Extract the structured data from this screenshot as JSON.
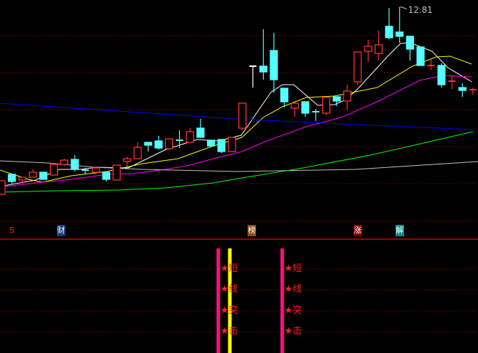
{
  "chart_data": {
    "type": "candlestick",
    "title": "",
    "max_label": "12.81",
    "grid": true,
    "colors": {
      "up": "#ff3030",
      "down": "#54ffff",
      "flat": "#ffffff",
      "grid": "#c00000"
    },
    "candles": [
      [
        7.55,
        7.93,
        7.55,
        7.93,
        "up"
      ],
      [
        8.11,
        8.11,
        7.85,
        7.91,
        "down"
      ],
      [
        7.95,
        8.03,
        7.85,
        8.03,
        "up"
      ],
      [
        8.03,
        8.25,
        8.03,
        8.17,
        "up"
      ],
      [
        8.17,
        8.17,
        7.97,
        7.97,
        "down"
      ],
      [
        8.09,
        8.39,
        8.09,
        8.39,
        "up"
      ],
      [
        8.39,
        8.55,
        8.35,
        8.51,
        "up"
      ],
      [
        8.53,
        8.65,
        8.19,
        8.27,
        "down"
      ],
      [
        8.23,
        8.29,
        8.11,
        8.23,
        "down"
      ],
      [
        8.17,
        8.29,
        8.11,
        8.29,
        "up"
      ],
      [
        8.17,
        8.17,
        7.91,
        7.97,
        "down"
      ],
      [
        7.95,
        8.37,
        7.95,
        8.37,
        "up"
      ],
      [
        8.47,
        8.61,
        8.33,
        8.55,
        "up"
      ],
      [
        8.55,
        9.01,
        8.55,
        8.87,
        "up"
      ],
      [
        9.01,
        9.01,
        8.75,
        8.93,
        "down"
      ],
      [
        9.05,
        9.19,
        8.81,
        8.85,
        "down"
      ],
      [
        8.83,
        9.11,
        8.79,
        9.11,
        "up"
      ],
      [
        9.07,
        9.35,
        8.85,
        9.07,
        "down"
      ],
      [
        9.01,
        9.41,
        9.01,
        9.31,
        "up"
      ],
      [
        9.41,
        9.67,
        9.15,
        9.15,
        "down"
      ],
      [
        9.07,
        9.07,
        8.91,
        8.91,
        "down"
      ],
      [
        9.09,
        9.09,
        8.71,
        8.75,
        "down"
      ],
      [
        8.75,
        9.15,
        8.75,
        9.15,
        "up"
      ],
      [
        9.41,
        10.11,
        9.35,
        10.11,
        "up"
      ],
      [
        11.15,
        11.15,
        10.55,
        11.15,
        "flat"
      ],
      [
        11.15,
        12.19,
        10.77,
        10.99,
        "down"
      ],
      [
        11.59,
        12.09,
        10.41,
        10.77,
        "down"
      ],
      [
        10.53,
        10.53,
        9.99,
        10.15,
        "down"
      ],
      [
        9.97,
        10.13,
        9.73,
        10.11,
        "up"
      ],
      [
        10.15,
        10.15,
        9.73,
        9.83,
        "down"
      ],
      [
        9.87,
        9.95,
        9.61,
        9.87,
        "down"
      ],
      [
        9.83,
        10.27,
        9.77,
        10.27,
        "up"
      ],
      [
        10.29,
        10.29,
        10.03,
        10.17,
        "down"
      ],
      [
        10.17,
        10.63,
        9.91,
        10.45,
        "up"
      ],
      [
        10.71,
        11.55,
        10.61,
        11.55,
        "up"
      ],
      [
        11.57,
        11.89,
        11.27,
        11.71,
        "up"
      ],
      [
        11.51,
        12.15,
        11.31,
        11.75,
        "up"
      ],
      [
        12.27,
        12.79,
        11.91,
        11.95,
        "down"
      ],
      [
        12.11,
        12.81,
        11.81,
        11.99,
        "down"
      ],
      [
        11.99,
        11.99,
        11.31,
        11.63,
        "down"
      ],
      [
        11.69,
        11.69,
        11.17,
        11.17,
        "down"
      ],
      [
        11.17,
        11.35,
        11.05,
        11.17,
        "up"
      ],
      [
        11.17,
        11.23,
        10.55,
        10.63,
        "down"
      ],
      [
        10.73,
        10.87,
        10.51,
        10.73,
        "up"
      ],
      [
        10.55,
        10.67,
        10.29,
        10.47,
        "down"
      ],
      [
        10.49,
        10.55,
        10.35,
        10.49,
        "up"
      ]
    ],
    "lines": [
      {
        "color": "#ffffff",
        "points": [
          [
            0.86,
            7.77
          ],
          [
            4.26,
            7.95
          ],
          [
            6.5,
            8.25
          ],
          [
            8.5,
            8.25
          ],
          [
            10.2,
            8.31
          ],
          [
            13.1,
            8.29
          ],
          [
            16.7,
            8.81
          ],
          [
            19.7,
            9.09
          ],
          [
            21.7,
            9.05
          ],
          [
            23.9,
            9.21
          ],
          [
            26.7,
            10.41
          ],
          [
            27.8,
            10.63
          ],
          [
            28.9,
            10.63
          ],
          [
            31.2,
            10.05
          ],
          [
            32.8,
            10.07
          ],
          [
            33.9,
            10.21
          ],
          [
            35.0,
            10.51
          ],
          [
            38.0,
            11.47
          ],
          [
            39.1,
            11.79
          ],
          [
            40.0,
            11.81
          ],
          [
            42.1,
            11.57
          ],
          [
            43.6,
            11.11
          ],
          [
            45.9,
            10.71
          ]
        ]
      },
      {
        "color": "#ffff00",
        "points": [
          [
            0.86,
            8.23
          ],
          [
            3.58,
            7.97
          ],
          [
            4.94,
            7.89
          ],
          [
            7.65,
            8.07
          ],
          [
            11.05,
            8.19
          ],
          [
            14.44,
            8.41
          ],
          [
            17.84,
            8.55
          ],
          [
            21.23,
            8.91
          ],
          [
            23.95,
            9.15
          ],
          [
            25.98,
            9.71
          ],
          [
            27.82,
            10.01
          ],
          [
            30.06,
            10.27
          ],
          [
            32.77,
            10.31
          ],
          [
            36.85,
            10.55
          ],
          [
            40.24,
            11.15
          ],
          [
            42.48,
            11.41
          ],
          [
            43.84,
            11.43
          ],
          [
            45.87,
            11.21
          ]
        ]
      },
      {
        "color": "#ff00ff",
        "points": [
          [
            0.86,
            7.75
          ],
          [
            4.26,
            7.87
          ],
          [
            7.65,
            7.97
          ],
          [
            11.05,
            8.11
          ],
          [
            13.56,
            8.13
          ],
          [
            16.68,
            8.25
          ],
          [
            18.99,
            8.37
          ],
          [
            21.23,
            8.55
          ],
          [
            23.95,
            8.75
          ],
          [
            25.98,
            9.01
          ],
          [
            30.06,
            9.45
          ],
          [
            33.45,
            9.71
          ],
          [
            36.85,
            10.15
          ],
          [
            40.92,
            10.75
          ],
          [
            43.16,
            10.89
          ],
          [
            45.87,
            10.85
          ]
        ]
      },
      {
        "color": "#0000ff",
        "points": [
          [
            0.86,
            10.11
          ],
          [
            23.27,
            9.67
          ],
          [
            34.8,
            9.51
          ],
          [
            45.87,
            9.37
          ]
        ]
      },
      {
        "color": "#c0c0c0",
        "points": [
          [
            0.86,
            8.49
          ],
          [
            5.41,
            8.43
          ],
          [
            9.89,
            8.31
          ],
          [
            14.44,
            8.25
          ],
          [
            23.47,
            8.19
          ],
          [
            34.81,
            8.25
          ],
          [
            46.49,
            8.47
          ]
        ]
      },
      {
        "color": "#00ff00",
        "points": [
          [
            0.86,
            7.61
          ],
          [
            6.5,
            7.65
          ],
          [
            12.2,
            7.67
          ],
          [
            16.68,
            7.73
          ],
          [
            21.23,
            7.87
          ],
          [
            23.95,
            8.01
          ],
          [
            29.4,
            8.27
          ],
          [
            36.2,
            8.65
          ],
          [
            41.6,
            9.01
          ],
          [
            46.0,
            9.31
          ]
        ]
      }
    ]
  },
  "markers": [
    {
      "label": "S",
      "candle": 2,
      "bg": "#000000",
      "color": "#ff2020"
    },
    {
      "label": "财",
      "candle": 6.7,
      "bg": "#123a78",
      "color": "#ffffff"
    },
    {
      "label": "榜",
      "candle": 24.9,
      "bg": "#8a4a10",
      "color": "#ffffff"
    },
    {
      "label": "涨",
      "candle": 35,
      "bg": "#8a0000",
      "color": "#ffffff"
    },
    {
      "label": "解",
      "candle": 39,
      "bg": "#0a8a8a",
      "color": "#ffffff"
    }
  ],
  "signals": {
    "bars": [
      {
        "candle": 21.7,
        "color": "#ff1080"
      },
      {
        "candle": 22.8,
        "color": "#ffff00"
      },
      {
        "candle": 27.8,
        "color": "#ff1080"
      }
    ],
    "labels": [
      "★短",
      "★线",
      "★突",
      "★击"
    ],
    "groups": [
      21.7,
      27.8
    ]
  }
}
